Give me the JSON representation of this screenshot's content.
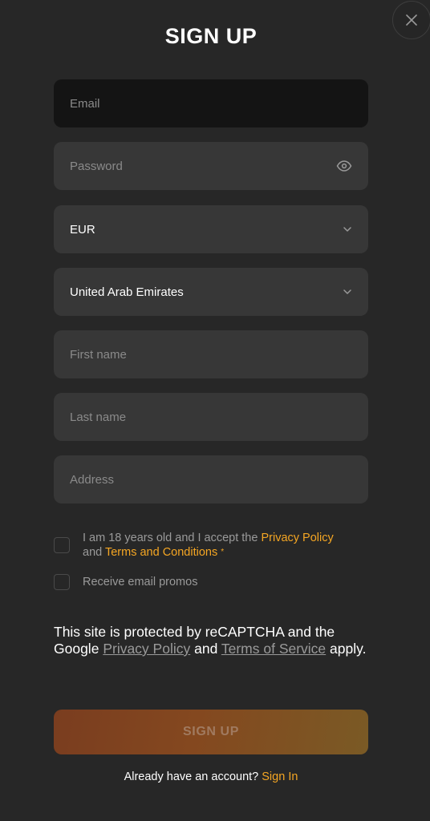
{
  "form": {
    "title": "SIGN UP",
    "email_placeholder": "Email",
    "password_placeholder": "Password",
    "currency_value": "EUR",
    "country_value": "United Arab Emirates",
    "first_name_placeholder": "First name",
    "last_name_placeholder": "Last name",
    "address_placeholder": "Address"
  },
  "consent": {
    "age_text": "I am 18 years old and I accept the",
    "privacy_link": "Privacy Policy",
    "and_text": "and",
    "terms_link": "Terms and Conditions",
    "required_mark": "*",
    "promos_text": "Receive email promos"
  },
  "recaptcha": {
    "text_before": "This site is protected by reCAPTCHA and the Google",
    "privacy_link": "Privacy Policy",
    "and_text": "and",
    "terms_link": "Terms of Service",
    "text_after": "apply."
  },
  "actions": {
    "signup_label": "SIGN UP",
    "have_account_text": "Already have an account?",
    "signin_link": "Sign In"
  },
  "icons": {
    "close": "close-icon",
    "password_toggle": "eye-icon",
    "dropdown": "chevron-down-icon"
  },
  "colors": {
    "background": "#272727",
    "field": "#373737",
    "field_focused": "#141414",
    "accent": "#f5a623"
  }
}
